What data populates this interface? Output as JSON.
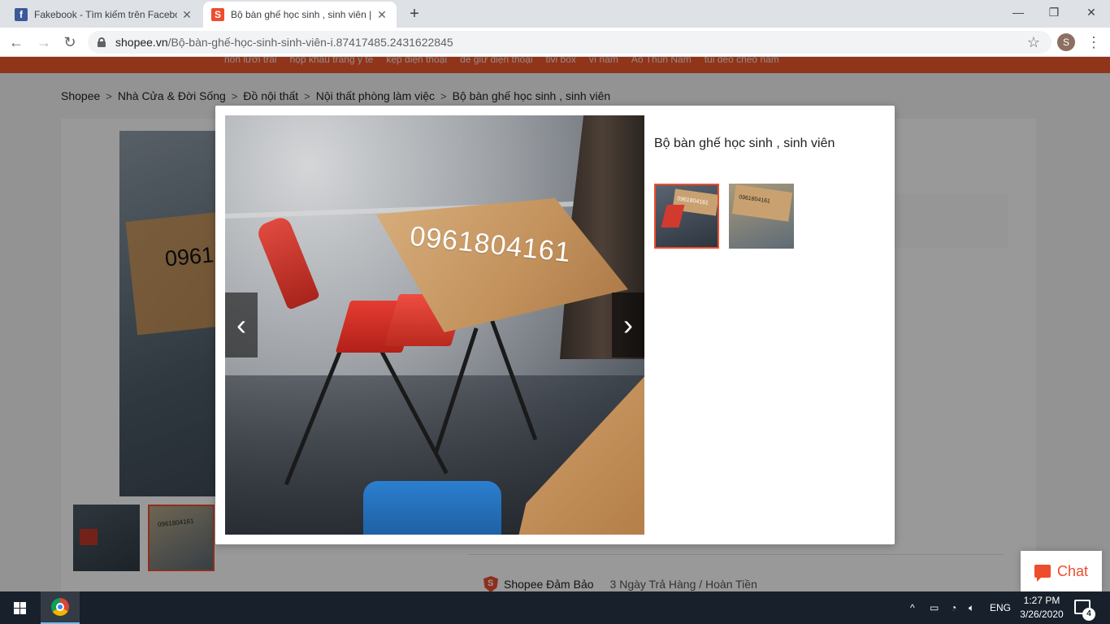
{
  "browser": {
    "tabs": [
      {
        "title": "Fakebook - Tìm kiếm trên Facebo",
        "favicon": "facebook-icon"
      },
      {
        "title": "Bộ bàn ghế học sinh , sinh viên |",
        "favicon": "shopee-icon",
        "active": true
      }
    ],
    "url_domain": "shopee.vn",
    "url_path": "/Bộ-bàn-ghế-học-sinh-sinh-viên-i.87417485.2431622845",
    "profile_initial": "S"
  },
  "page": {
    "top_keywords": [
      "nón lưỡi trai",
      "hộp khẩu trang y tế",
      "kẹp điện thoại",
      "đế giữ điện thoại",
      "tivi box",
      "ví nam",
      "Áo Thun Nam",
      "túi đeo chéo nam"
    ],
    "breadcrumb": [
      "Shopee",
      "Nhà Cửa & Đời Sống",
      "Đồ nội thất",
      "Nội thất phòng làm việc",
      "Bộ bàn ghế học sinh , sinh viên"
    ],
    "bg_phone_number": "0961",
    "thumb_phone_number": "0961804161",
    "guarantee_title": "Shopee Đảm Bảo",
    "guarantee_desc": "3 Ngày Trả Hàng / Hoàn Tiền"
  },
  "modal": {
    "title": "Bộ bàn ghế học sinh , sinh viên",
    "image_text": "0961804161",
    "thumb_text": "0961804161",
    "selected_thumb_index": 0
  },
  "chat": {
    "label": "Chat"
  },
  "taskbar": {
    "language": "ENG",
    "time": "1:27 PM",
    "date": "3/26/2020",
    "notification_count": "4"
  },
  "colors": {
    "brand": "#ee4d2d",
    "taskbar": "#18202c"
  }
}
